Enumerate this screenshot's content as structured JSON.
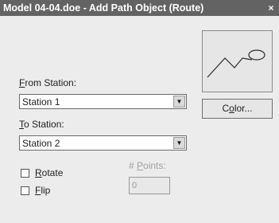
{
  "window": {
    "title": "Model 04-04.doe - Add Path Object (Route)",
    "close_label": "×"
  },
  "from_station": {
    "label_prefix": "",
    "label_accel": "F",
    "label_rest": "rom Station:",
    "value": "Station 1"
  },
  "to_station": {
    "label_accel": "T",
    "label_rest": "o Station:",
    "value": "Station 2"
  },
  "color_button": {
    "label_pre": "C",
    "label_accel": "o",
    "label_rest": "lor..."
  },
  "options": {
    "rotate": {
      "accel": "R",
      "rest": "otate",
      "checked": false
    },
    "flip": {
      "accel": "F",
      "rest": "lip",
      "checked": false
    }
  },
  "points": {
    "label_pre": "# ",
    "label_accel": "P",
    "label_rest": "oints:",
    "value": "0",
    "enabled": false
  },
  "icons": {
    "preview": "route-path-preview-icon",
    "dropdown": "chevron-down-icon"
  }
}
